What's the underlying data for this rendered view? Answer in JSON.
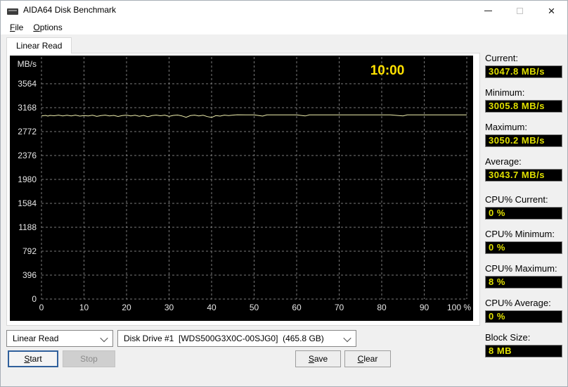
{
  "window": {
    "title": "AIDA64 Disk Benchmark"
  },
  "icons": {
    "app": "disk-drive",
    "minimize": "minimize-line",
    "maximize": "maximize-square",
    "close": "×",
    "chevron_down": "chevron-down"
  },
  "menu": {
    "items": [
      {
        "label": "File"
      },
      {
        "label": "Options"
      }
    ]
  },
  "tabs": [
    {
      "label": "Linear Read",
      "active": true
    }
  ],
  "chart": {
    "type": "line",
    "unit_label": "MB/s",
    "time_label": "10:00",
    "y_ticks": [
      3564,
      3168,
      2772,
      2376,
      1980,
      1584,
      1188,
      792,
      396,
      0
    ],
    "x_ticks": [
      "0",
      "10",
      "20",
      "30",
      "40",
      "50",
      "60",
      "70",
      "80",
      "90",
      "100 %"
    ],
    "xlabel_unit": "%",
    "ylim": [
      0,
      3960
    ],
    "grid": true,
    "colors": {
      "background": "#000000",
      "grid": "#7a7a7a",
      "tick_text": "#e6e6e6",
      "line": "#efefae",
      "time_text": "#ffe100"
    },
    "series": [
      {
        "name": "Linear Read",
        "unit": "MB/s",
        "points": [
          [
            0,
            3032
          ],
          [
            1,
            3040
          ],
          [
            1.5,
            3028
          ],
          [
            2,
            3040
          ],
          [
            3,
            3034
          ],
          [
            4,
            3044
          ],
          [
            5,
            3030
          ],
          [
            6,
            3042
          ],
          [
            7,
            3030
          ],
          [
            8,
            3044
          ],
          [
            9,
            3028
          ],
          [
            10,
            3038
          ],
          [
            11,
            3030
          ],
          [
            12,
            3042
          ],
          [
            13,
            3024
          ],
          [
            14,
            3038
          ],
          [
            15,
            3044
          ],
          [
            16,
            3030
          ],
          [
            17,
            3040
          ],
          [
            18,
            3022
          ],
          [
            19,
            3038
          ],
          [
            20,
            3044
          ],
          [
            21,
            3030
          ],
          [
            22,
            3042
          ],
          [
            23,
            3026
          ],
          [
            24,
            3040
          ],
          [
            25,
            3018
          ],
          [
            26,
            3036
          ],
          [
            27,
            3044
          ],
          [
            28,
            3034
          ],
          [
            29,
            3044
          ],
          [
            30,
            3024
          ],
          [
            31,
            3040
          ],
          [
            32,
            3046
          ],
          [
            33,
            3032
          ],
          [
            34,
            3008
          ],
          [
            35,
            3036
          ],
          [
            36,
            3044
          ],
          [
            37,
            3030
          ],
          [
            38,
            3042
          ],
          [
            39,
            3020
          ],
          [
            40,
            3006
          ],
          [
            41,
            3036
          ],
          [
            42,
            3028
          ],
          [
            43,
            3044
          ],
          [
            44,
            3036
          ],
          [
            45,
            3044
          ],
          [
            46,
            3050
          ],
          [
            48,
            3048
          ],
          [
            50,
            3048
          ],
          [
            52,
            3028
          ],
          [
            53,
            3048
          ],
          [
            56,
            3048
          ],
          [
            60,
            3048
          ],
          [
            62,
            3030
          ],
          [
            63,
            3048
          ],
          [
            67,
            3048
          ],
          [
            70,
            3048
          ],
          [
            74,
            3048
          ],
          [
            78,
            3048
          ],
          [
            82,
            3048
          ],
          [
            85,
            3032
          ],
          [
            86,
            3048
          ],
          [
            90,
            3048
          ],
          [
            94,
            3048
          ],
          [
            98,
            3048
          ],
          [
            100,
            3048
          ]
        ]
      }
    ]
  },
  "stats": {
    "items": [
      {
        "label": "Current:",
        "value": "3047.8 MB/s"
      },
      {
        "label": "Minimum:",
        "value": "3005.8 MB/s"
      },
      {
        "label": "Maximum:",
        "value": "3050.2 MB/s"
      },
      {
        "label": "Average:",
        "value": "3043.7 MB/s"
      },
      {
        "label": "CPU% Current:",
        "value": "0 %"
      },
      {
        "label": "CPU% Minimum:",
        "value": "0 %"
      },
      {
        "label": "CPU% Maximum:",
        "value": "8 %"
      },
      {
        "label": "CPU% Average:",
        "value": "0 %"
      },
      {
        "label": "Block Size:",
        "value": "8 MB"
      }
    ]
  },
  "controls": {
    "benchmark_type": {
      "value": "Linear Read"
    },
    "disk_drive": {
      "value": "Disk Drive #1  [WDS500G3X0C-00SJG0]  (465.8 GB)"
    },
    "buttons": {
      "start": "Start",
      "stop": "Stop",
      "save": "Save",
      "clear": "Clear"
    }
  },
  "colors": {
    "accent_focus": "#30609c",
    "value_text": "#e0e000",
    "window_bg": "#f0f0f0"
  }
}
